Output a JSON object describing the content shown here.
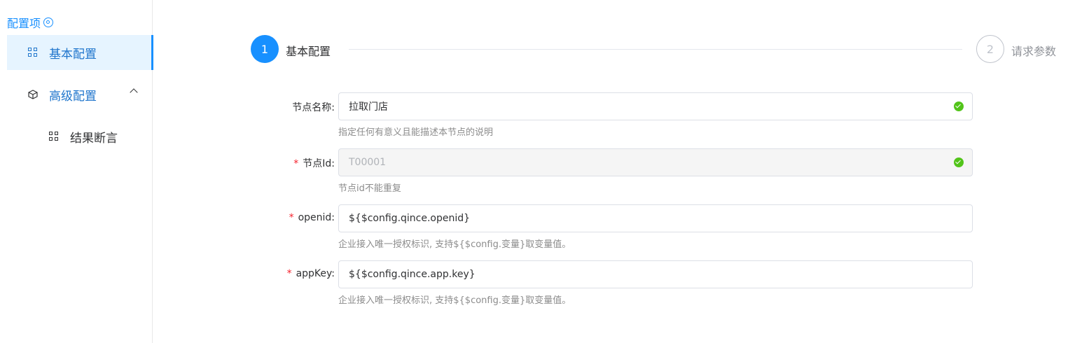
{
  "sidebar": {
    "title": "配置项",
    "items": [
      {
        "label": "基本配置"
      },
      {
        "label": "高级配置"
      },
      {
        "label": "结果断言"
      }
    ]
  },
  "steps": [
    {
      "number": "1",
      "label": "基本配置"
    },
    {
      "number": "2",
      "label": "请求参数"
    }
  ],
  "form": {
    "node_name": {
      "label": "节点名称:",
      "value": "拉取门店",
      "help": "指定任何有意义且能描述本节点的说明"
    },
    "node_id": {
      "label": "节点Id:",
      "value": "T00001",
      "help": "节点id不能重复"
    },
    "openid": {
      "label": "openid:",
      "value": "${$config.qince.openid}",
      "help": "企业接入唯一授权标识, 支持${$config.变量}取变量值。"
    },
    "appkey": {
      "label": "appKey:",
      "value": "${$config.qince.app.key}",
      "help": "企业接入唯一授权标识, 支持${$config.变量}取变量值。"
    }
  },
  "colors": {
    "accent": "#1890ff",
    "success": "#52c41a",
    "required": "#f5222d"
  }
}
